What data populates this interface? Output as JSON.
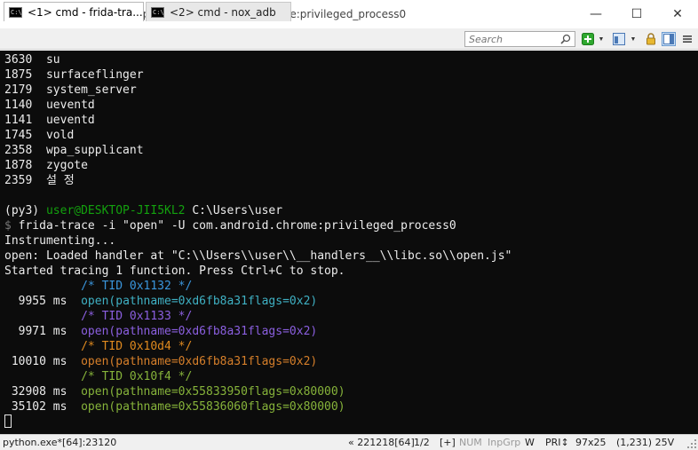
{
  "window": {
    "title": "cmd - frida-trace  -i \"open\" -U com.android.chrome:privileged_process0",
    "app_icon_glyph": "C",
    "controls": {
      "minimize": "—",
      "maximize": "☐",
      "close": "✕"
    }
  },
  "tabs": [
    {
      "label": "<1> cmd - frida-tra...",
      "active": true
    },
    {
      "label": "<2> cmd - nox_adb",
      "active": false
    }
  ],
  "search": {
    "placeholder": "Search",
    "value": ""
  },
  "toolbar_icons": [
    "add-console-icon",
    "dropdown-arrow-icon",
    "panes-icon",
    "dropdown-arrow-icon",
    "lock-icon",
    "layout-icon",
    "menu-icon"
  ],
  "colors": {
    "console_bg": "#0c0c0c",
    "prompt_green": "#13a10e",
    "tid_teal": "#3a96dd",
    "tid_purple": "#8b5fe0",
    "tid_orange": "#e08a1e",
    "tid_lime": "#86b33a"
  },
  "console": {
    "processes": [
      {
        "pid": "3630",
        "name": "su"
      },
      {
        "pid": "1875",
        "name": "surfaceflinger"
      },
      {
        "pid": "2179",
        "name": "system_server"
      },
      {
        "pid": "1140",
        "name": "ueventd"
      },
      {
        "pid": "1141",
        "name": "ueventd"
      },
      {
        "pid": "1745",
        "name": "vold"
      },
      {
        "pid": "2358",
        "name": "wpa_supplicant"
      },
      {
        "pid": "1878",
        "name": "zygote"
      },
      {
        "pid": "2359",
        "name": "설 정"
      }
    ],
    "prompt": {
      "env": "(py3)",
      "user_host": "user@DESKTOP-JII5KL2",
      "path": "C:\\Users\\user",
      "symbol": "$",
      "command": "frida-trace -i \"open\" -U com.android.chrome:privileged_process0"
    },
    "instrumenting": "Instrumenting...",
    "loaded_handler": "open: Loaded handler at \"C:\\\\Users\\\\user\\\\__handlers__\\\\libc.so\\\\open.js\"",
    "started": "Started tracing 1 function. Press Ctrl+C to stop.",
    "trace": [
      {
        "tid": "/* TID 0x1132 */",
        "ms": "9955 ms",
        "call": "open(pathname=0xd6fb8a31flags=0x2)"
      },
      {
        "tid": "/* TID 0x1133 */",
        "ms": "9971 ms",
        "call": "open(pathname=0xd6fb8a31flags=0x2)"
      },
      {
        "tid": "/* TID 0x10d4 */",
        "ms": "10010 ms",
        "call": "open(pathname=0xd6fb8a31flags=0x2)"
      },
      {
        "tid": "/* TID 0x10f4 */",
        "ms": "32908 ms",
        "call": "open(pathname=0x55833950flags=0x80000)"
      },
      {
        "tid": "",
        "ms": "35102 ms",
        "call": "open(pathname=0x55836060flags=0x80000)"
      }
    ]
  },
  "status": {
    "process": "python.exe*[64]:23120",
    "position": "« 221218[64]",
    "page": "1/2",
    "plus": "[+]",
    "num": "NUM",
    "inpgrp": "InpGrp",
    "w": "W",
    "pri": "PRI↕",
    "size": "97x25",
    "cursor": "(1,231) 25V"
  }
}
